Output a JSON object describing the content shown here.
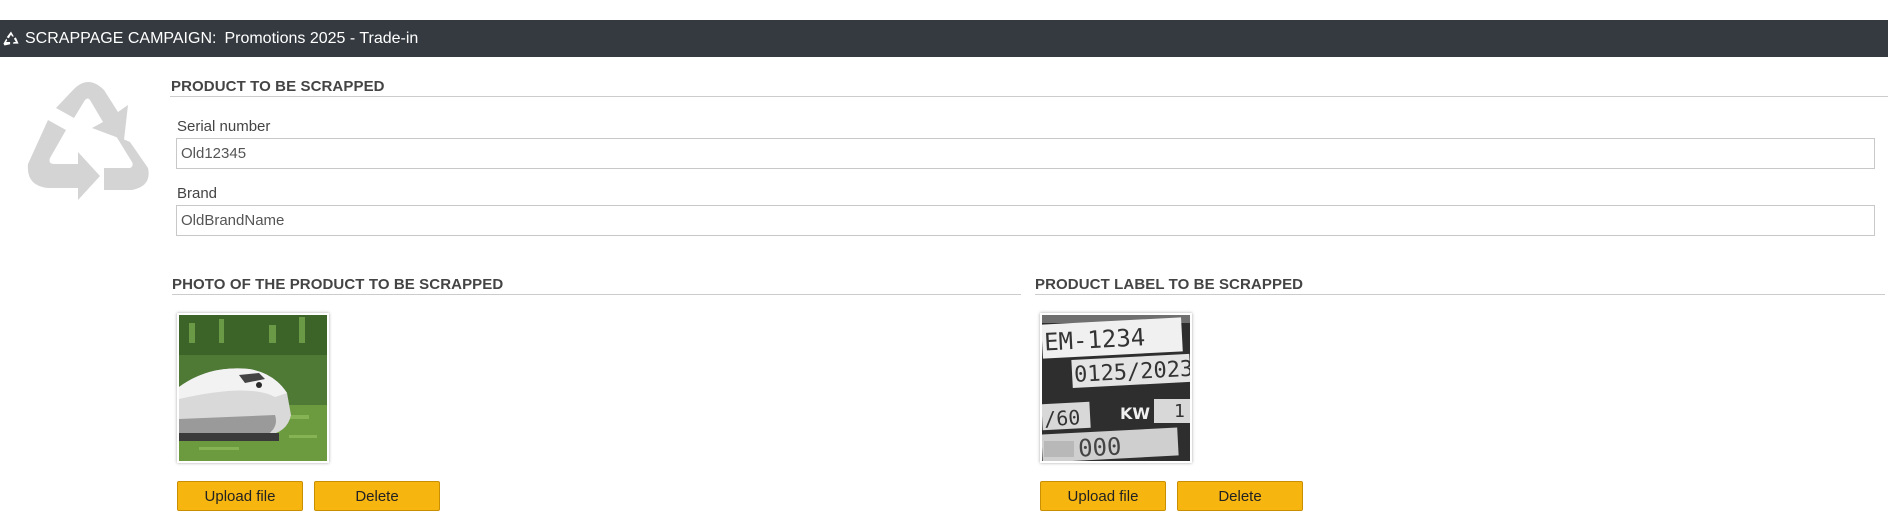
{
  "header": {
    "icon": "recycle-icon",
    "title_prefix": "SCRAPPAGE CAMPAIGN:",
    "campaign_name": "Promotions 2025 - Trade-in",
    "background": "#343a40"
  },
  "product_section": {
    "title": "PRODUCT TO BE SCRAPPED",
    "fields": {
      "serial": {
        "label": "Serial number",
        "value": "Old12345"
      },
      "brand": {
        "label": "Brand",
        "value": "OldBrandName"
      }
    }
  },
  "photo_section": {
    "title": "PHOTO OF THE PRODUCT TO BE SCRAPPED",
    "image": "robotic-lawnmower-photo",
    "upload_label": "Upload file",
    "delete_label": "Delete"
  },
  "label_section": {
    "title": "PRODUCT LABEL TO BE SCRAPPED",
    "image": "product-label-photo",
    "label_lines": [
      "EM-1234",
      "0125/2023",
      "/60",
      "KW",
      "1",
      "000"
    ],
    "upload_label": "Upload file",
    "delete_label": "Delete"
  },
  "colors": {
    "button": "#f7b50f",
    "header": "#343a40",
    "icon_gray": "#d4d4d4"
  }
}
